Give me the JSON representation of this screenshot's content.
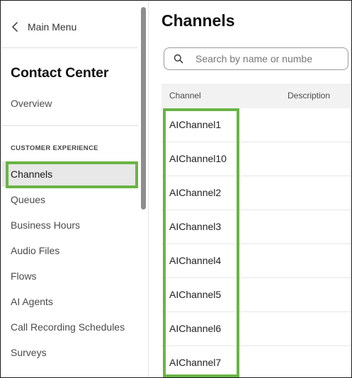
{
  "sidebar": {
    "back_label": "Main Menu",
    "app_title": "Contact Center",
    "overview_label": "Overview",
    "section_label": "CUSTOMER EXPERIENCE",
    "items": [
      {
        "label": "Channels",
        "active": true
      },
      {
        "label": "Queues"
      },
      {
        "label": "Business Hours"
      },
      {
        "label": "Audio Files"
      },
      {
        "label": "Flows"
      },
      {
        "label": "AI Agents"
      },
      {
        "label": "Call Recording Schedules"
      },
      {
        "label": "Surveys"
      }
    ]
  },
  "main": {
    "title": "Channels",
    "search": {
      "placeholder": "Search by name or numbe",
      "value": ""
    },
    "columns": [
      "Channel",
      "Description"
    ],
    "rows": [
      {
        "channel": "AIChannel1",
        "description": ""
      },
      {
        "channel": "AIChannel10",
        "description": ""
      },
      {
        "channel": "AIChannel2",
        "description": ""
      },
      {
        "channel": "AIChannel3",
        "description": ""
      },
      {
        "channel": "AIChannel4",
        "description": ""
      },
      {
        "channel": "AIChannel5",
        "description": ""
      },
      {
        "channel": "AIChannel6",
        "description": ""
      },
      {
        "channel": "AIChannel7",
        "description": ""
      }
    ]
  },
  "colors": {
    "highlight": "#6ab446",
    "active_bg": "#e8e8e8",
    "header_bg": "#f2f2f2"
  },
  "icons": {
    "back": "chevron-left-icon",
    "search": "search-icon"
  }
}
